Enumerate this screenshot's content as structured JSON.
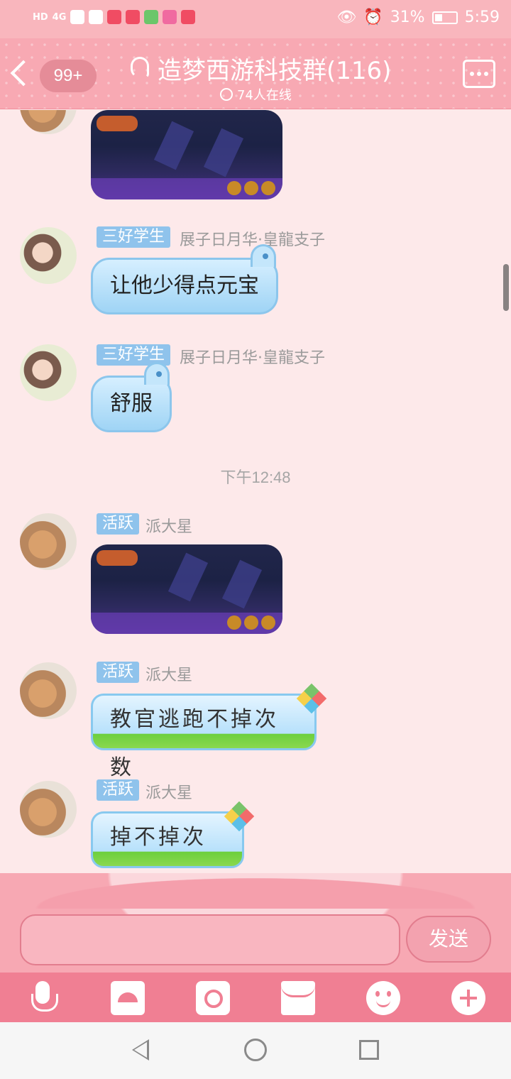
{
  "status": {
    "hd": "HD",
    "net": "4G",
    "battery": "31%",
    "time": "5:59"
  },
  "header": {
    "unread_badge": "99+",
    "title": "造梦西游科技群(116)",
    "online": "74人在线"
  },
  "messages": [
    {
      "type": "image",
      "sender_tag": "",
      "sender": ""
    },
    {
      "type": "text",
      "sender_tag": "三好学生",
      "sender": "展子日月华·皇龍支子",
      "text": "让他少得点元宝"
    },
    {
      "type": "text",
      "sender_tag": "三好学生",
      "sender": "展子日月华·皇龍支子",
      "text": "舒服"
    },
    {
      "type": "time",
      "text": "下午12:48"
    },
    {
      "type": "image",
      "sender_tag": "活跃",
      "sender": "派大星"
    },
    {
      "type": "text",
      "sender_tag": "活跃",
      "sender": "派大星",
      "text": "教官逃跑不掉次数"
    },
    {
      "type": "text",
      "sender_tag": "活跃",
      "sender": "派大星",
      "text": "掉不掉次数"
    }
  ],
  "input": {
    "value": "",
    "send_label": "发送"
  },
  "toolbar": [
    "mic-icon",
    "picture-icon",
    "camera-icon",
    "red-packet-icon",
    "emoji-icon",
    "plus-icon"
  ],
  "colors": {
    "header": "#f8a9b3",
    "background": "#fde9ea",
    "tag": "#8fc3ec",
    "toolbar": "#f07f93"
  }
}
